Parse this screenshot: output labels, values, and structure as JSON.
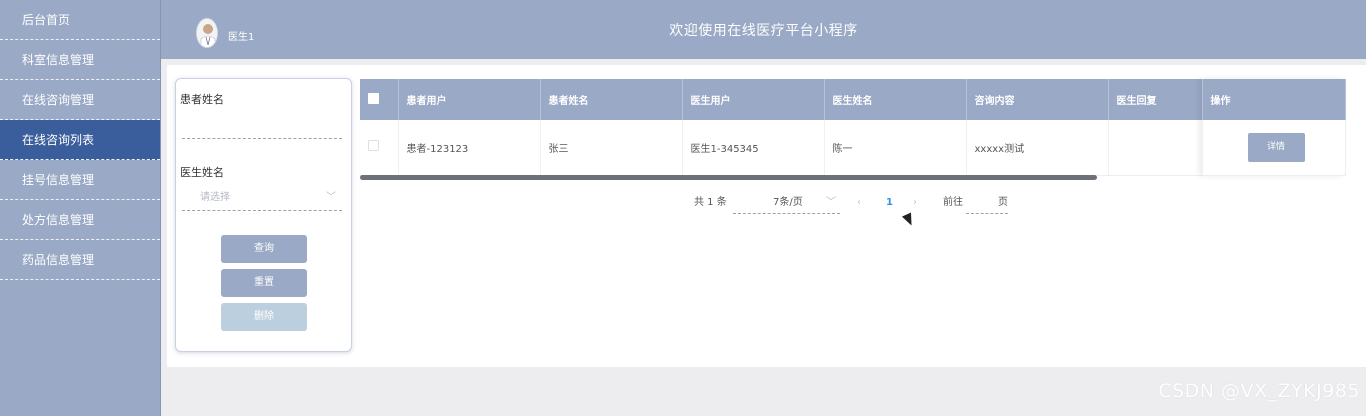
{
  "sidebar": {
    "items": [
      {
        "label": "后台首页",
        "active": false
      },
      {
        "label": "科室信息管理",
        "active": false
      },
      {
        "label": "在线咨询管理",
        "active": false
      },
      {
        "label": "在线咨询列表",
        "active": true
      },
      {
        "label": "挂号信息管理",
        "active": false
      },
      {
        "label": "处方信息管理",
        "active": false
      },
      {
        "label": "药品信息管理",
        "active": false
      }
    ]
  },
  "header": {
    "user": "医生1",
    "title": "欢迎使用在线医疗平台小程序"
  },
  "filter": {
    "patient_name_label": "患者姓名",
    "patient_name_value": "",
    "doctor_name_label": "医生姓名",
    "doctor_name_placeholder": "请选择",
    "search_button": "查询",
    "reset_button": "重置",
    "delete_button": "删除"
  },
  "table": {
    "columns": [
      "患者用户",
      "患者姓名",
      "医生用户",
      "医生姓名",
      "咨询内容",
      "医生回复",
      "操作"
    ],
    "rows": [
      {
        "patient_user": "患者-123123",
        "patient_name": "张三",
        "doctor_user": "医生1-345345",
        "doctor_name": "陈一",
        "content": "xxxxx测试",
        "reply": "",
        "action": "详情"
      }
    ]
  },
  "pagination": {
    "total": "共 1 条",
    "page_size": "7条/页",
    "current_page": "1",
    "goto_label": "前往",
    "page_unit": "页"
  },
  "watermark": "CSDN @VX_ZYKJ985",
  "colors": {
    "sidebar_bg": "#9aa9c5",
    "sidebar_active": "#3a5e9c",
    "accent": "#3a8ee6"
  }
}
